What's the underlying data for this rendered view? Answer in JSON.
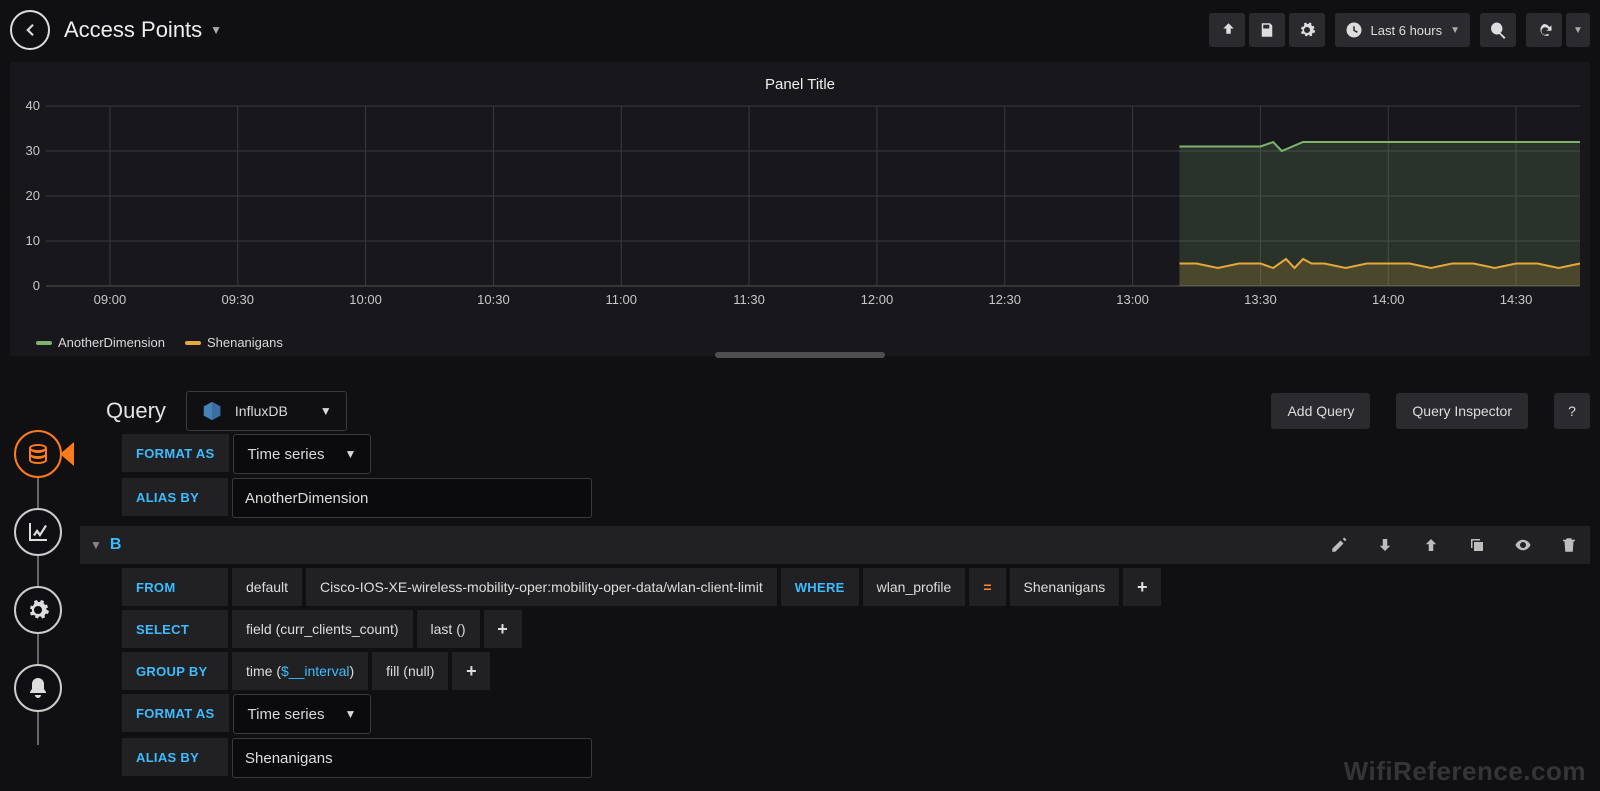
{
  "header": {
    "title": "Access Points",
    "time_range": "Last 6 hours"
  },
  "panel": {
    "title": "Panel Title",
    "legend": [
      "AnotherDimension",
      "Shenanigans"
    ],
    "colors": {
      "AnotherDimension": "#7EB26D",
      "Shenanigans": "#E5A83B"
    }
  },
  "chart_data": {
    "type": "line",
    "title": "Panel Title",
    "xlabel": "",
    "ylabel": "",
    "ylim": [
      0,
      40
    ],
    "x_ticks": [
      "09:00",
      "09:30",
      "10:00",
      "10:30",
      "11:00",
      "11:30",
      "12:00",
      "12:30",
      "13:00",
      "13:30",
      "14:00",
      "14:30"
    ],
    "y_ticks": [
      0,
      10,
      20,
      30,
      40
    ],
    "x_domain": [
      "08:45",
      "14:45"
    ],
    "series": [
      {
        "name": "AnotherDimension",
        "color": "#7EB26D",
        "x": [
          "13:11",
          "13:15",
          "13:20",
          "13:25",
          "13:30",
          "13:33",
          "13:35",
          "13:40",
          "13:45",
          "13:50",
          "13:55",
          "14:00",
          "14:10",
          "14:20",
          "14:30",
          "14:45"
        ],
        "values": [
          31,
          31,
          31,
          31,
          31,
          32,
          30,
          32,
          32,
          32,
          32,
          32,
          32,
          32,
          32,
          32
        ]
      },
      {
        "name": "Shenanigans",
        "color": "#E5A83B",
        "x": [
          "13:11",
          "13:15",
          "13:20",
          "13:25",
          "13:30",
          "13:33",
          "13:36",
          "13:38",
          "13:40",
          "13:42",
          "13:45",
          "13:50",
          "13:55",
          "14:00",
          "14:05",
          "14:10",
          "14:15",
          "14:20",
          "14:25",
          "14:30",
          "14:35",
          "14:40",
          "14:45"
        ],
        "values": [
          5,
          5,
          4,
          5,
          5,
          4,
          6,
          4,
          6,
          5,
          5,
          4,
          5,
          5,
          5,
          4,
          5,
          5,
          4,
          5,
          5,
          4,
          5
        ]
      }
    ]
  },
  "query_editor": {
    "title": "Query",
    "datasource": "InfluxDB",
    "add_query": "Add Query",
    "inspector": "Query Inspector",
    "help": "?"
  },
  "labels": {
    "format_as": "FORMAT AS",
    "alias_by": "ALIAS BY",
    "from": "FROM",
    "where": "WHERE",
    "select": "SELECT",
    "group_by": "GROUP BY"
  },
  "queryA": {
    "format_as": "Time series",
    "alias_by": "AnotherDimension"
  },
  "queryB": {
    "id": "B",
    "from_policy": "default",
    "from_measurement": "Cisco-IOS-XE-wireless-mobility-oper:mobility-oper-data/wlan-client-limit",
    "where_key": "wlan_profile",
    "where_op": "=",
    "where_val": "Shenanigans",
    "select_field": "field (curr_clients_count)",
    "select_agg": "last ()",
    "group_time_pre": "time (",
    "group_time_var": "$__interval",
    "group_time_post": ")",
    "group_fill": "fill (null)",
    "format_as": "Time series",
    "alias_by": "Shenanigans",
    "plus": "+"
  },
  "watermark": "WifiReference.com"
}
